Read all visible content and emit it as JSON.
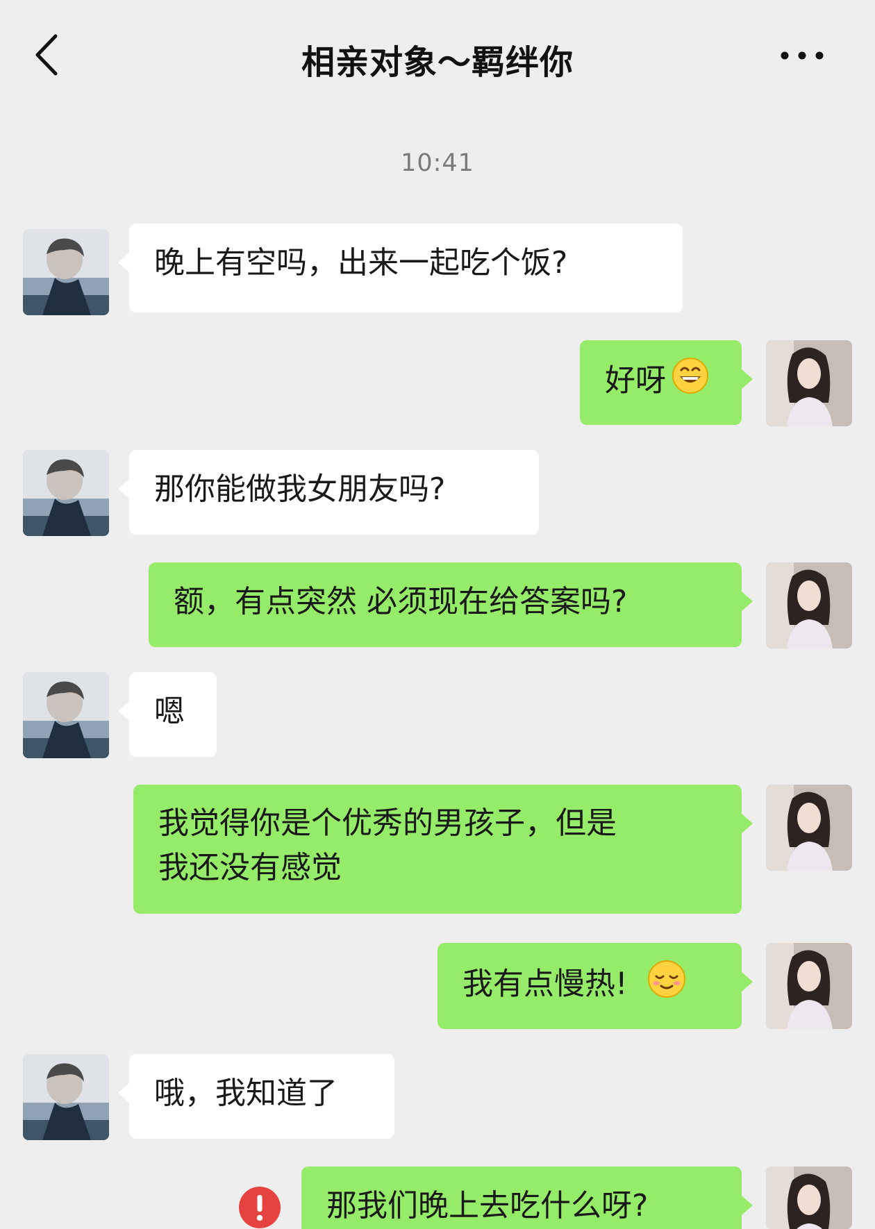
{
  "header": {
    "title": "相亲对象～羁绊你"
  },
  "chat": {
    "timestamp": "10:41",
    "messages": [
      {
        "sender": "other",
        "text": "晚上有空吗，出来一起吃个饭?"
      },
      {
        "sender": "me",
        "text": "好呀",
        "emoji": "grinning-face-emoji"
      },
      {
        "sender": "other",
        "text": "那你能做我女朋友吗?"
      },
      {
        "sender": "me",
        "text": "额，有点突然 必须现在给答案吗?"
      },
      {
        "sender": "other",
        "text": "嗯"
      },
      {
        "sender": "me",
        "text_line1": "我觉得你是个优秀的男孩子，但是",
        "text_line2": "我还没有感觉"
      },
      {
        "sender": "me",
        "text": "我有点慢热!",
        "emoji": "shy-smile-emoji"
      },
      {
        "sender": "other",
        "text": "哦，我知道了"
      },
      {
        "sender": "me",
        "text": "那我们晚上去吃什么呀?",
        "status": "send-failed"
      }
    ]
  },
  "colors": {
    "background": "#eeeeee",
    "outgoing_bubble": "#95ec69",
    "incoming_bubble": "#ffffff",
    "error": "#e64340"
  }
}
